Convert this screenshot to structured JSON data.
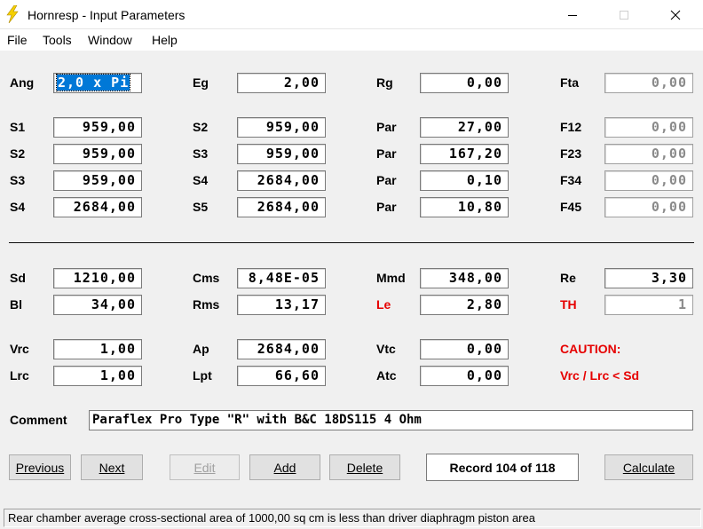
{
  "window": {
    "title": "Hornresp - Input Parameters"
  },
  "menu": [
    "File",
    "Tools",
    "Window",
    "Help"
  ],
  "rows": [
    {
      "cells": [
        {
          "label": "Ang",
          "value": "2,0 x Pi",
          "selected": true
        },
        {
          "label": "Eg",
          "value": "2,00"
        },
        {
          "label": "Rg",
          "value": "0,00"
        },
        {
          "label": "Fta",
          "value": "0,00",
          "disabled": true
        }
      ]
    },
    {
      "cells": [
        {
          "label": "S1",
          "value": "959,00"
        },
        {
          "label": "S2",
          "value": "959,00"
        },
        {
          "label": "Par",
          "value": "27,00"
        },
        {
          "label": "F12",
          "value": "0,00",
          "disabled": true
        }
      ]
    },
    {
      "cells": [
        {
          "label": "S2",
          "value": "959,00"
        },
        {
          "label": "S3",
          "value": "959,00"
        },
        {
          "label": "Par",
          "value": "167,20"
        },
        {
          "label": "F23",
          "value": "0,00",
          "disabled": true
        }
      ]
    },
    {
      "cells": [
        {
          "label": "S3",
          "value": "959,00"
        },
        {
          "label": "S4",
          "value": "2684,00"
        },
        {
          "label": "Par",
          "value": "0,10"
        },
        {
          "label": "F34",
          "value": "0,00",
          "disabled": true
        }
      ]
    },
    {
      "cells": [
        {
          "label": "S4",
          "value": "2684,00"
        },
        {
          "label": "S5",
          "value": "2684,00"
        },
        {
          "label": "Par",
          "value": "10,80"
        },
        {
          "label": "F45",
          "value": "0,00",
          "disabled": true
        }
      ]
    },
    {
      "cells": [
        {
          "label": "Sd",
          "value": "1210,00"
        },
        {
          "label": "Cms",
          "value": "8,48E-05"
        },
        {
          "label": "Mmd",
          "value": "348,00"
        },
        {
          "label": "Re",
          "value": "3,30"
        }
      ]
    },
    {
      "cells": [
        {
          "label": "Bl",
          "value": "34,00"
        },
        {
          "label": "Rms",
          "value": "13,17"
        },
        {
          "label": "Le",
          "value": "2,80",
          "red": true
        },
        {
          "label": "TH",
          "value": "1",
          "red": true,
          "disabled": true
        }
      ]
    },
    {
      "cells": [
        {
          "label": "Vrc",
          "value": "1,00"
        },
        {
          "label": "Ap",
          "value": "2684,00"
        },
        {
          "label": "Vtc",
          "value": "0,00"
        },
        {
          "label": "CAUTION:",
          "red": true,
          "noField": true
        }
      ]
    },
    {
      "cells": [
        {
          "label": "Lrc",
          "value": "1,00"
        },
        {
          "label": "Lpt",
          "value": "66,60"
        },
        {
          "label": "Atc",
          "value": "0,00"
        },
        {
          "label": "Vrc / Lrc < Sd",
          "red": true,
          "noField": true
        }
      ]
    }
  ],
  "comment": {
    "label": "Comment",
    "value": "Paraflex Pro Type \"R\" with B&C 18DS115 4 Ohm"
  },
  "buttons": {
    "previous": "Previous",
    "next": "Next",
    "edit": "Edit",
    "add": "Add",
    "delete": "Delete",
    "calculate": "Calculate"
  },
  "record": "Record 104 of 118",
  "status": "Rear chamber average cross-sectional area of 1000,00 sq cm is less than driver diaphragm piston area",
  "colors": {
    "warning": "#e60000",
    "selection": "#0078d7",
    "icon": "#f5d000"
  }
}
